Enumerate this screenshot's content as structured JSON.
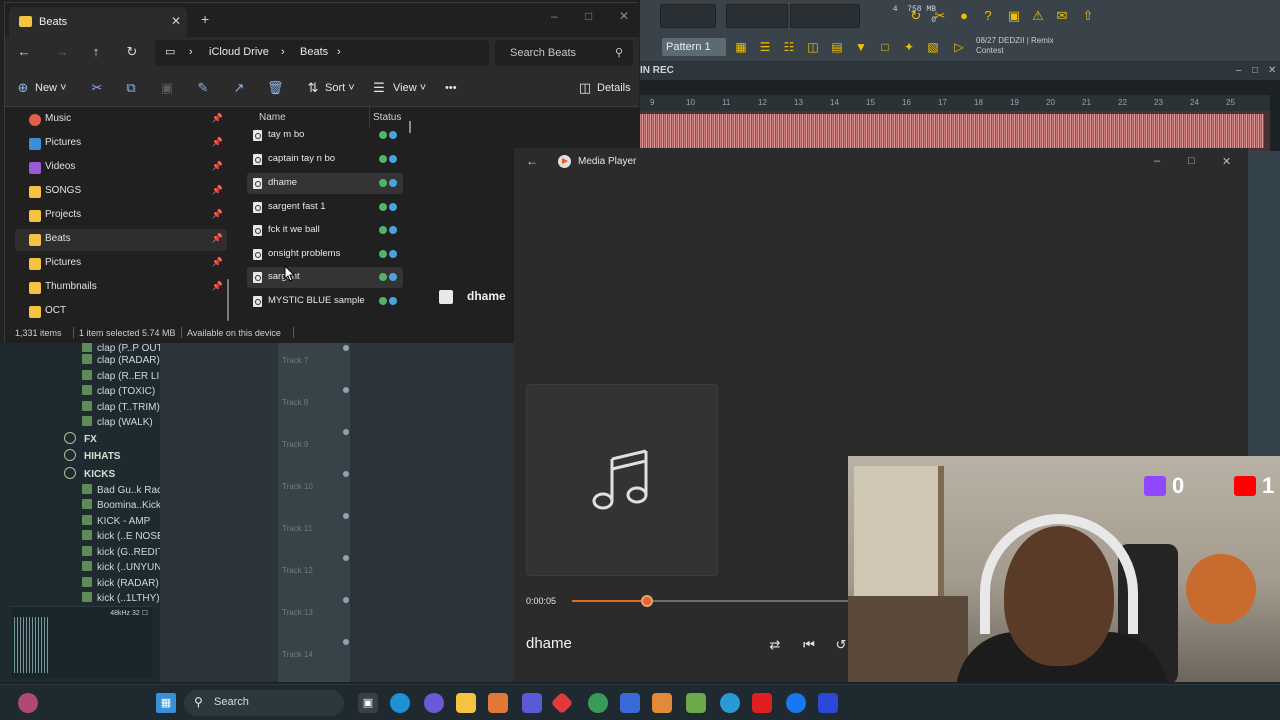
{
  "fl_studio": {
    "cpu_readout_top": "758 MB",
    "cpu_readout_bottom": "0",
    "cpu_num": "4",
    "pattern_label": "Pattern 1",
    "news_text": "08/27  DEDZII | Remix Contest",
    "playlist_title": "IN REC",
    "timeline_numbers": [
      "9",
      "10",
      "11",
      "12",
      "13",
      "14",
      "15",
      "16",
      "17",
      "18",
      "19",
      "20",
      "21",
      "22",
      "23",
      "24",
      "25"
    ],
    "browser_items": [
      "clap (P..P OUT)",
      "clap (RADAR)",
      "clap (R..ER LIE)",
      "clap (TOXIC)",
      "clap (T..TRIM)",
      "clap (WALK)"
    ],
    "browser_folders": [
      "FX",
      "HIHATS",
      "KICKS"
    ],
    "kick_items": [
      "Bad Gu..k Rack",
      "Boomina..Kick)",
      "KICK - AMP",
      "kick (..E NOSE)",
      "kick (G..REDIT)",
      "kick (..UNYUN)",
      "kick (RADAR)",
      "kick (..1LTHY)"
    ],
    "sample_meta": "48kHz 32 ☐",
    "tracks": [
      "Track 7",
      "Track 8",
      "Track 9",
      "Track 10",
      "Track 11",
      "Track 12",
      "Track 13",
      "Track 14"
    ]
  },
  "explorer": {
    "tab_label": "Beats",
    "tab_close": "✕",
    "new_tab": "+",
    "breadcrumb": [
      "iCloud Drive",
      "Beats"
    ],
    "search_placeholder": "Search Beats",
    "commands": {
      "new_label": "New",
      "sort_label": "Sort",
      "view_label": "View",
      "details_label": "Details",
      "more": "•••"
    },
    "sidebar": [
      {
        "label": "Music",
        "icon": "music-icon",
        "color": "#e0604a"
      },
      {
        "label": "Pictures",
        "icon": "pictures-icon",
        "color": "#3a8fd9"
      },
      {
        "label": "Videos",
        "icon": "videos-icon",
        "color": "#9a5cd6"
      },
      {
        "label": "SONGS",
        "icon": "folder-icon",
        "color": "#f5c242"
      },
      {
        "label": "Projects",
        "icon": "folder-icon",
        "color": "#f5c242"
      },
      {
        "label": "Beats",
        "icon": "folder-icon",
        "color": "#f5c242"
      },
      {
        "label": "Pictures",
        "icon": "folder-icon",
        "color": "#f5c242"
      },
      {
        "label": "Thumbnails",
        "icon": "folder-icon",
        "color": "#f5c242"
      },
      {
        "label": "OCT",
        "icon": "folder-icon",
        "color": "#f5c242"
      }
    ],
    "columns": {
      "name": "Name",
      "status": "Status"
    },
    "files": [
      "tay m bo",
      "captain tay n bo",
      "dhame",
      "sargent fast 1",
      "fck it we ball",
      "onsight problems",
      "sargent",
      "MYSTIC BLUE sample"
    ],
    "preview_title": "dhame",
    "status": {
      "items": "1,331 items",
      "selected": "1 item selected  5.74 MB",
      "availability": "Available on this device"
    }
  },
  "media_player": {
    "app_title": "Media Player",
    "elapsed": "0:00:05",
    "progress_fraction": 0.27,
    "song_title": "dhame"
  },
  "stream": {
    "twitch_count": "0",
    "youtube_count": "1",
    "twitch_color": "#9146ff",
    "youtube_color": "#ff0000"
  },
  "taskbar": {
    "search_label": "Search"
  },
  "colors": {
    "accent_orange": "#e06a2c",
    "sync_green": "#4fb36c",
    "sync_blue": "#4aa3e0"
  }
}
